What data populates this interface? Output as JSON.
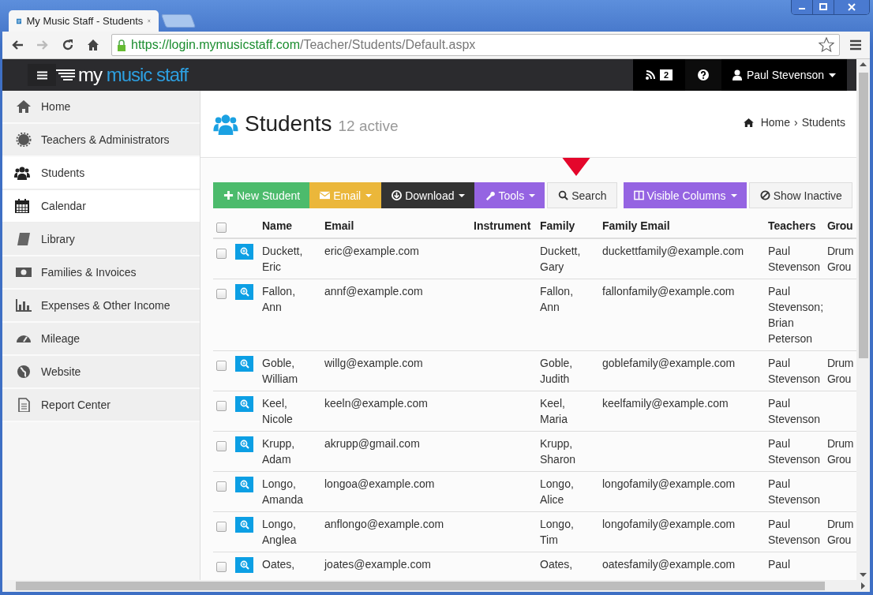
{
  "browser": {
    "tab_title": "My Music Staff - Students",
    "url_host": "https://login.mymusicstaff.com",
    "url_path": "/Teacher/Students/Default.aspx"
  },
  "navbar": {
    "logo_first": "my",
    "logo_second": "music staff",
    "feed_count": "2",
    "user": "Paul Stevenson"
  },
  "sidebar": {
    "items": [
      {
        "label": "Home",
        "selected": false
      },
      {
        "label": "Teachers & Administrators",
        "selected": false
      },
      {
        "label": "Students",
        "selected": true
      },
      {
        "label": "Calendar",
        "selected": true
      },
      {
        "label": "Library",
        "selected": false
      },
      {
        "label": "Families & Invoices",
        "selected": false
      },
      {
        "label": "Expenses & Other Income",
        "selected": false
      },
      {
        "label": "Mileage",
        "selected": false
      },
      {
        "label": "Website",
        "selected": false
      },
      {
        "label": "Report Center",
        "selected": false
      }
    ]
  },
  "page": {
    "title": "Students",
    "count": "12 active",
    "breadcrumb": [
      "Home",
      "Students"
    ],
    "breadcrumb_separator": "›"
  },
  "toolbar": [
    {
      "label": "New Student",
      "kind": "success",
      "dropdown": false
    },
    {
      "label": "Email",
      "kind": "warning",
      "dropdown": true
    },
    {
      "label": "Download",
      "kind": "dark",
      "dropdown": true
    },
    {
      "label": "Tools",
      "kind": "purple",
      "dropdown": true
    },
    {
      "label": "Search",
      "kind": "plain",
      "dropdown": false
    },
    {
      "label": "Visible Columns",
      "kind": "purple",
      "dropdown": true
    },
    {
      "label": "Show Inactive",
      "kind": "plain",
      "dropdown": false
    }
  ],
  "table": {
    "all_checked": false,
    "columns": [
      "Name",
      "Email",
      "Instrument",
      "Family",
      "Family Email",
      "Teachers",
      "Grou"
    ],
    "rows": [
      {
        "checked": false,
        "name": "Duckett, Eric",
        "email": "eric@example.com",
        "family": "Duckett, Gary",
        "family_email": "duckettfamily@example.com",
        "teachers": "Paul Stevenson",
        "group": "Drum Grou"
      },
      {
        "checked": false,
        "name": "Fallon, Ann",
        "email": "annf@example.com",
        "family": "Fallon, Ann",
        "family_email": "fallonfamily@example.com",
        "teachers": "Paul Stevenson; Brian Peterson"
      },
      {
        "checked": false,
        "name": "Goble, William",
        "email": "willg@example.com",
        "family": "Goble, Judith",
        "family_email": "goblefamily@example.com",
        "teachers": "Paul Stevenson",
        "group": "Drum Grou"
      },
      {
        "checked": false,
        "name": "Keel, Nicole",
        "email": "keeln@example.com",
        "family": "Keel, Maria",
        "family_email": "keelfamily@example.com",
        "teachers": "Paul Stevenson"
      },
      {
        "checked": false,
        "name": "Krupp, Adam",
        "email": "akrupp@gmail.com",
        "family": "Krupp, Sharon",
        "teachers": "Paul Stevenson",
        "group": "Drum Grou"
      },
      {
        "checked": false,
        "name": "Longo, Amanda",
        "email": "longoa@example.com",
        "family": "Longo, Alice",
        "family_email": "longofamily@example.com",
        "teachers": "Paul Stevenson"
      },
      {
        "checked": false,
        "name": "Longo, Anglea",
        "email": "anflongo@example.com",
        "family": "Longo, Tim",
        "family_email": "longofamily@example.com",
        "teachers": "Paul Stevenson",
        "group": "Drum Grou"
      },
      {
        "checked": false,
        "name": "Oates,",
        "email": "joates@example.com",
        "family": "Oates,",
        "family_email": "oatesfamily@example.com",
        "teachers": "Paul"
      }
    ]
  }
}
